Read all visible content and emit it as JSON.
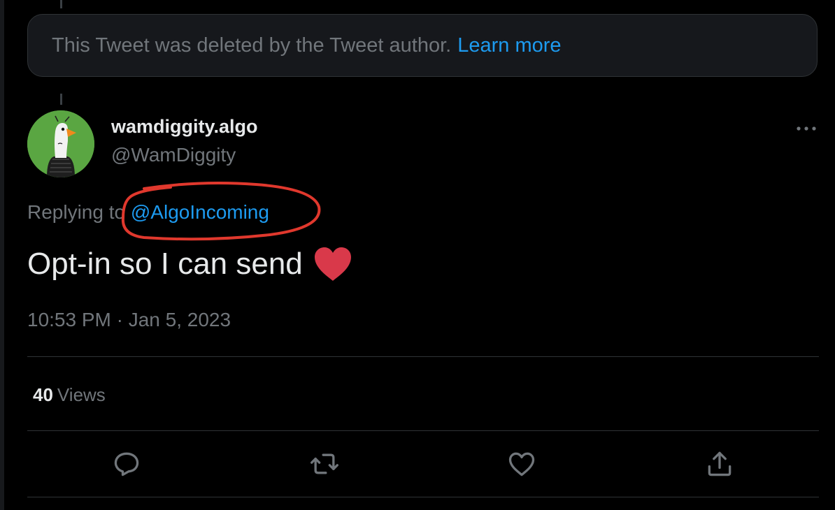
{
  "deleted_notice": {
    "text": "This Tweet was deleted by the Tweet author.",
    "link": "Learn more"
  },
  "tweet": {
    "display_name": "wamdiggity.algo",
    "handle": "@WamDiggity",
    "replying_prefix": "Replying to",
    "replying_mention": "@AlgoIncoming",
    "text": "Opt-in so I can send",
    "emoji": "heart-emoji",
    "timestamp": "10:53 PM · Jan 5, 2023",
    "views_count": "40",
    "views_label": "Views"
  },
  "actions": [
    {
      "name": "reply",
      "icon": "reply-icon"
    },
    {
      "name": "retweet",
      "icon": "retweet-icon"
    },
    {
      "name": "like",
      "icon": "heart-icon"
    },
    {
      "name": "share",
      "icon": "share-icon"
    }
  ],
  "colors": {
    "background": "#000000",
    "link": "#1d9bf0",
    "muted": "#71767b",
    "text": "#e7e9ea",
    "annotation": "#e0382d",
    "heart_emoji": "#d9394a"
  }
}
